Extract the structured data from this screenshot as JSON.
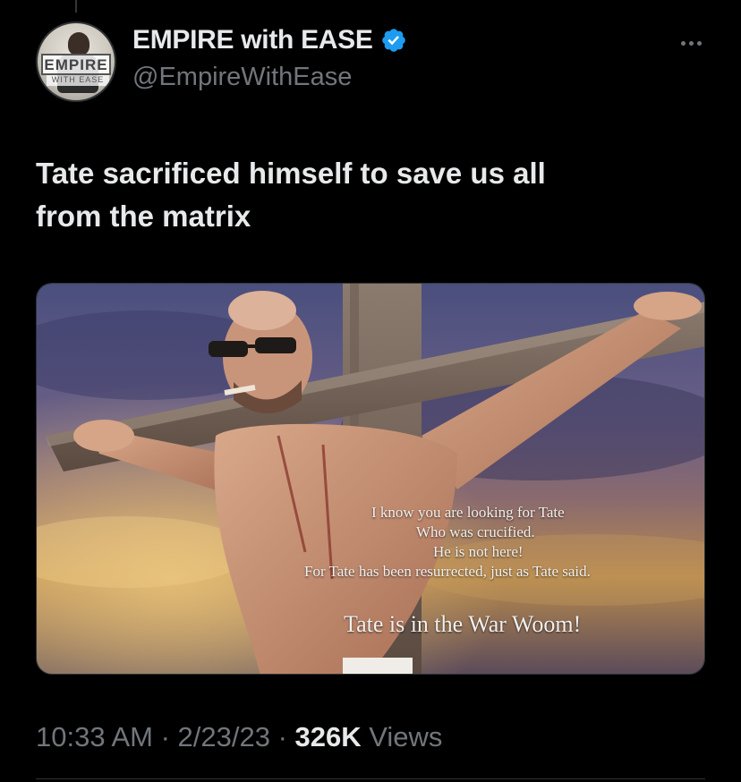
{
  "tweet": {
    "author": {
      "display_name": "EMPIRE with EASE",
      "handle": "@EmpireWithEase",
      "verified": true,
      "avatar_logo": "EMPIRE",
      "avatar_logo_sub": "WITH EASE",
      "verified_color": "#1d9bf0"
    },
    "text_line1": "Tate sacrificed himself to save us all",
    "text_line2": "from the matrix",
    "media": {
      "caption_line1": "I know you are looking for Tate",
      "caption_line2": "Who was crucified.",
      "caption_line3": "He is not here!",
      "caption_line4": "For Tate has been resurrected, just as Tate said.",
      "caption_line5": "Tate is in the War Woom!"
    },
    "meta": {
      "time": "10:33 AM",
      "separator": " · ",
      "date": "2/23/23",
      "views_count": "326K",
      "views_label": " Views"
    }
  },
  "icons": {
    "verified": "verified-badge-icon",
    "more": "more-options-icon"
  }
}
